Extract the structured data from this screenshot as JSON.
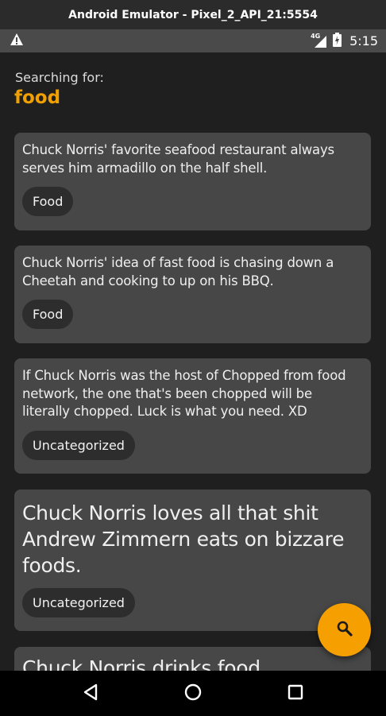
{
  "window": {
    "title": "Android Emulator - Pixel_2_API_21:5554"
  },
  "statusbar": {
    "network": "4G",
    "time": "5:15"
  },
  "search": {
    "label": "Searching for:",
    "term": "food"
  },
  "jokes": [
    {
      "text": "Chuck Norris' favorite seafood restaurant always serves him armadillo on the half shell.",
      "category": "Food"
    },
    {
      "text": "Chuck Norris' idea of fast food is chasing down a Cheetah and cooking to up on his BBQ.",
      "category": "Food"
    },
    {
      "text": "If Chuck Norris was the host of Chopped from food network, the one that's been chopped will be literally chopped. Luck is what you need. XD",
      "category": "Uncategorized"
    },
    {
      "text": "Chuck Norris loves all that shit Andrew Zimmern eats on bizzare foods.",
      "category": "Uncategorized"
    },
    {
      "text": "Chuck Norris drinks food"
    }
  ],
  "icons": {
    "warning": "warning-icon",
    "signal": "signal-icon",
    "battery": "battery-charging-icon",
    "fab": "search-icon",
    "nav_back": "back-icon",
    "nav_home": "home-icon",
    "nav_recent": "recents-icon"
  },
  "colors": {
    "accent": "#f5a000",
    "card": "#474747",
    "background": "#1f1f1f",
    "chip": "#2d2d2d"
  }
}
